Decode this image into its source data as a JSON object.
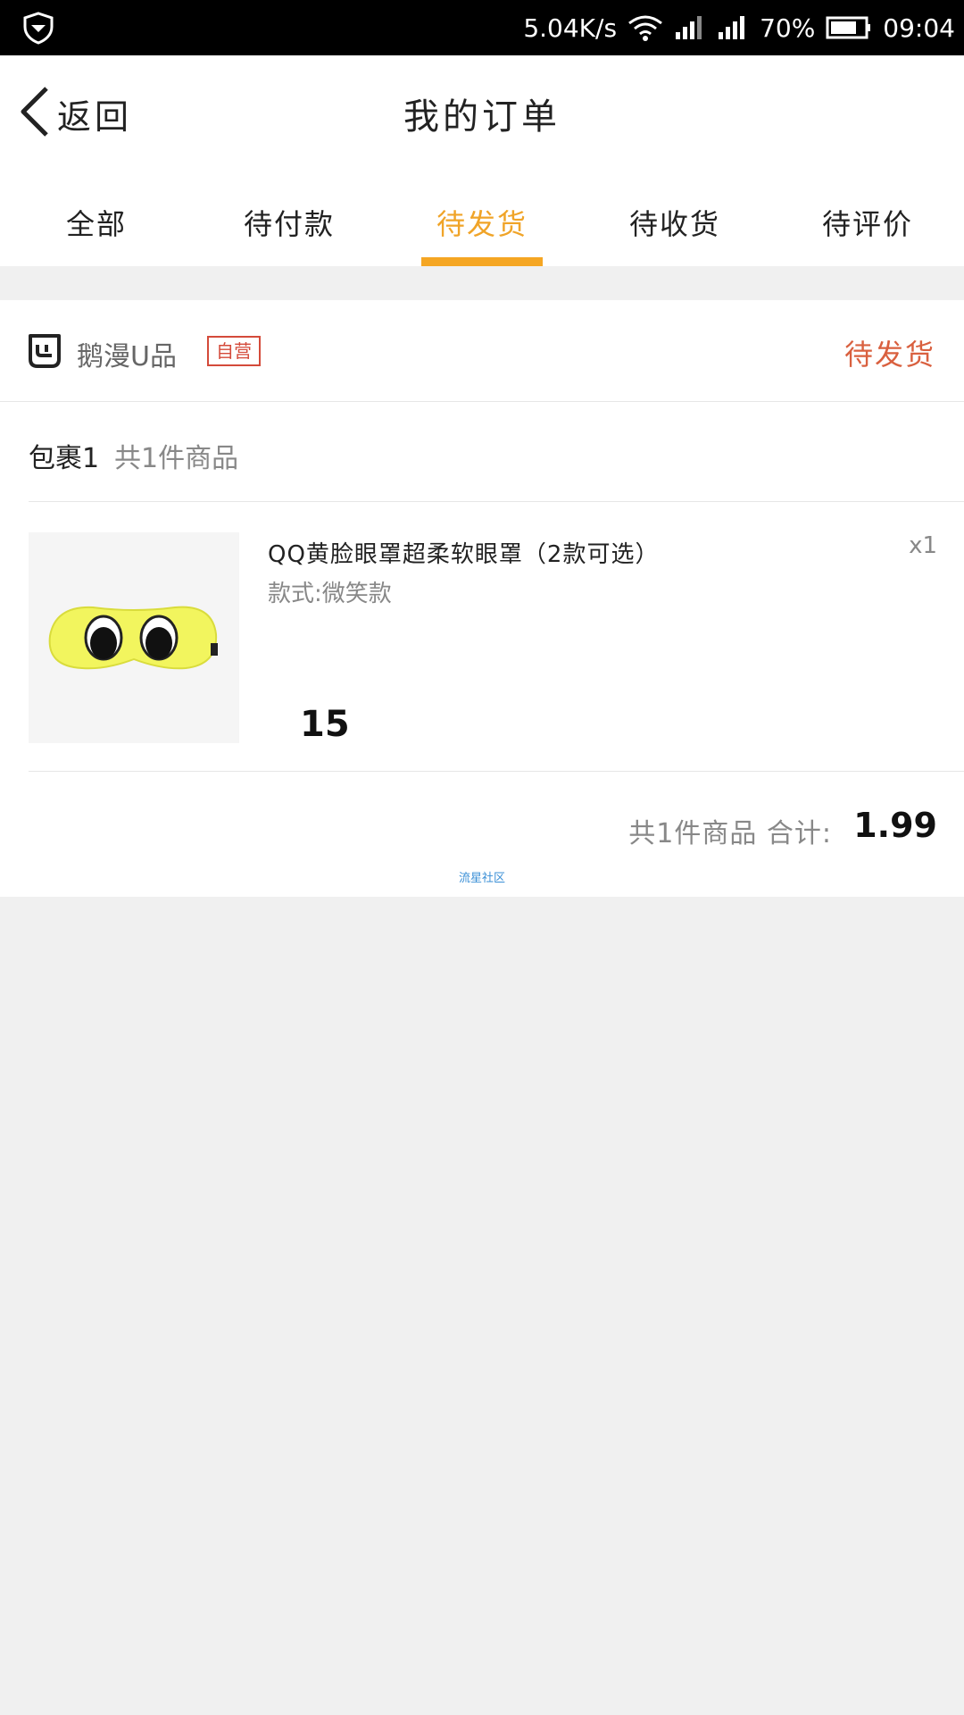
{
  "status_bar": {
    "network_speed": "5.04K/s",
    "battery": "70%",
    "time": "09:04",
    "icons": [
      "shield-icon",
      "wifi-icon",
      "signal-icon",
      "battery-icon"
    ]
  },
  "nav": {
    "back_label": "返回",
    "title": "我的订单"
  },
  "tabs": [
    {
      "label": "全部",
      "active": false
    },
    {
      "label": "待付款",
      "active": false
    },
    {
      "label": "待发货",
      "active": true
    },
    {
      "label": "待收货",
      "active": false
    },
    {
      "label": "待评价",
      "active": false
    }
  ],
  "order": {
    "store_name": "鹅漫U品",
    "store_badge": "自营",
    "status": "待发货",
    "package_label": "包裹1",
    "package_count": "共1件商品",
    "product": {
      "title": "QQ黄脸眼罩超柔软眼罩（2款可选）",
      "style": "款式:微笑款",
      "quantity": "x1",
      "price": "15"
    },
    "total_label": "共1件商品 合计:",
    "total_amount": "1.99",
    "watermark": "流星社区"
  },
  "colors": {
    "accent": "#f5a623",
    "status_red": "#d9603f",
    "badge_red": "#d44a3a",
    "background": "#f0f0f0"
  }
}
